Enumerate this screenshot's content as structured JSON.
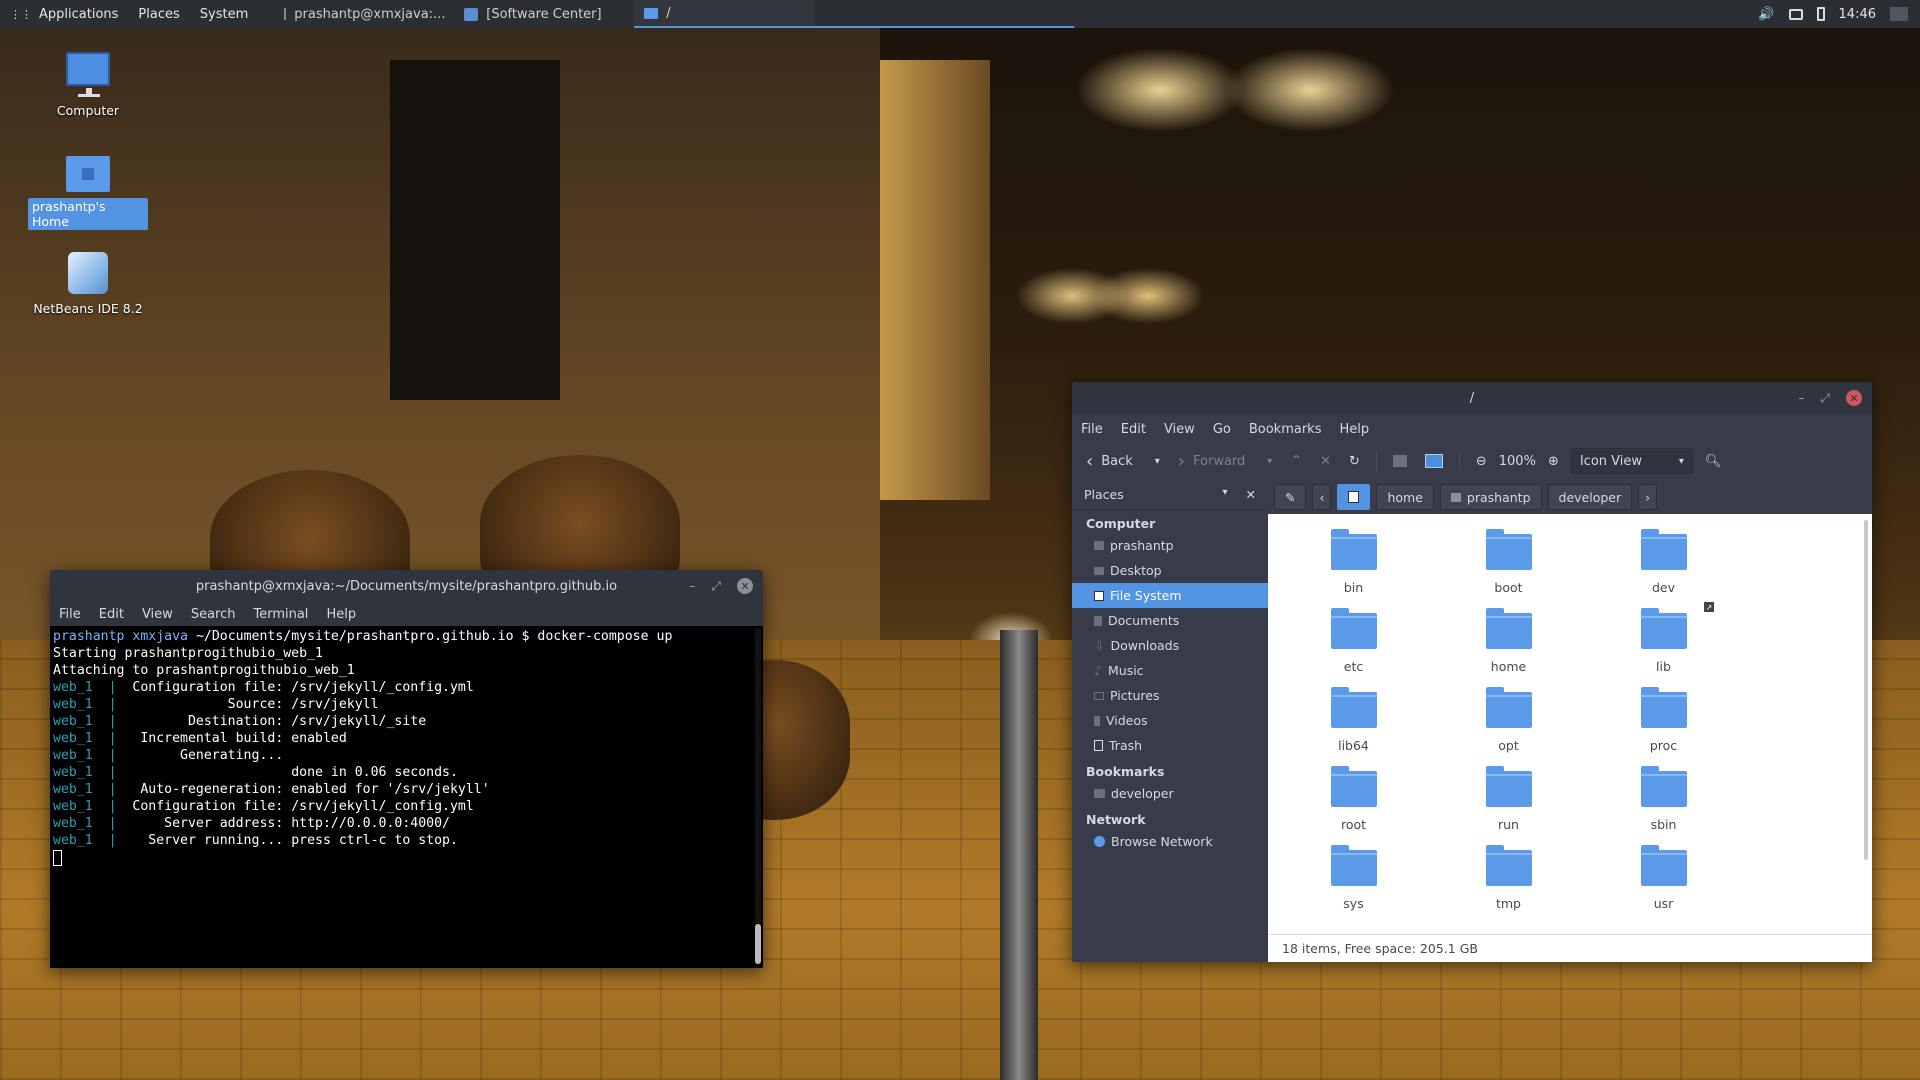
{
  "panel": {
    "applications": "Applications",
    "places": "Places",
    "system": "System",
    "tasks": [
      {
        "label": "prashantp@xmxjava:..."
      },
      {
        "label": "[Software Center]"
      },
      {
        "label": "/"
      }
    ],
    "clock": "14:46"
  },
  "desktop": {
    "icons": [
      {
        "label": "Computer"
      },
      {
        "label": "prashantp's Home"
      },
      {
        "label": "NetBeans IDE 8.2"
      }
    ]
  },
  "terminal": {
    "title": "prashantp@xmxjava:~/Documents/mysite/prashantpro.github.io",
    "menu": [
      "File",
      "Edit",
      "View",
      "Search",
      "Terminal",
      "Help"
    ],
    "prompt_user": "prashantp",
    "prompt_host": "xmxjava",
    "prompt_path": "~/Documents/mysite/prashantpro.github.io",
    "prompt_symbol": "$",
    "command": "docker-compose up",
    "lines": [
      "Starting prashantprogithubio_web_1",
      "Attaching to prashantprogithubio_web_1"
    ],
    "service": "web_1",
    "service_lines": [
      " Configuration file: /srv/jekyll/_config.yml",
      "             Source: /srv/jekyll",
      "        Destination: /srv/jekyll/_site",
      "  Incremental build: enabled",
      "       Generating...",
      "                     done in 0.06 seconds.",
      "  Auto-regeneration: enabled for '/srv/jekyll'",
      " Configuration file: /srv/jekyll/_config.yml",
      "     Server address: http://0.0.0.0:4000/",
      "   Server running... press ctrl-c to stop."
    ]
  },
  "filemanager": {
    "title": "/",
    "menu": [
      "File",
      "Edit",
      "View",
      "Go",
      "Bookmarks",
      "Help"
    ],
    "toolbar": {
      "back": "Back",
      "forward": "Forward",
      "zoom": "100%",
      "view_mode": "Icon View"
    },
    "sidebar": {
      "header": "Places",
      "computer_heading": "Computer",
      "computer_items": [
        "prashantp",
        "Desktop",
        "File System",
        "Documents",
        "Downloads",
        "Music",
        "Pictures",
        "Videos",
        "Trash"
      ],
      "selected": "File System",
      "bookmarks_heading": "Bookmarks",
      "bookmarks": [
        "developer"
      ],
      "network_heading": "Network",
      "network_items": [
        "Browse Network"
      ]
    },
    "path": [
      "home",
      "prashantp",
      "developer"
    ],
    "folders": [
      "bin",
      "boot",
      "dev",
      "etc",
      "home",
      "lib",
      "lib64",
      "opt",
      "proc",
      "root",
      "run",
      "sbin",
      "sys",
      "tmp",
      "usr"
    ],
    "status": "18 items, Free space: 205.1 GB"
  },
  "colors": {
    "accent": "#5294e2",
    "panel_bg": "#2b2e33",
    "window_bg": "#383c4a",
    "close_button": "#cc575d",
    "folder": "#5b9ae8"
  }
}
